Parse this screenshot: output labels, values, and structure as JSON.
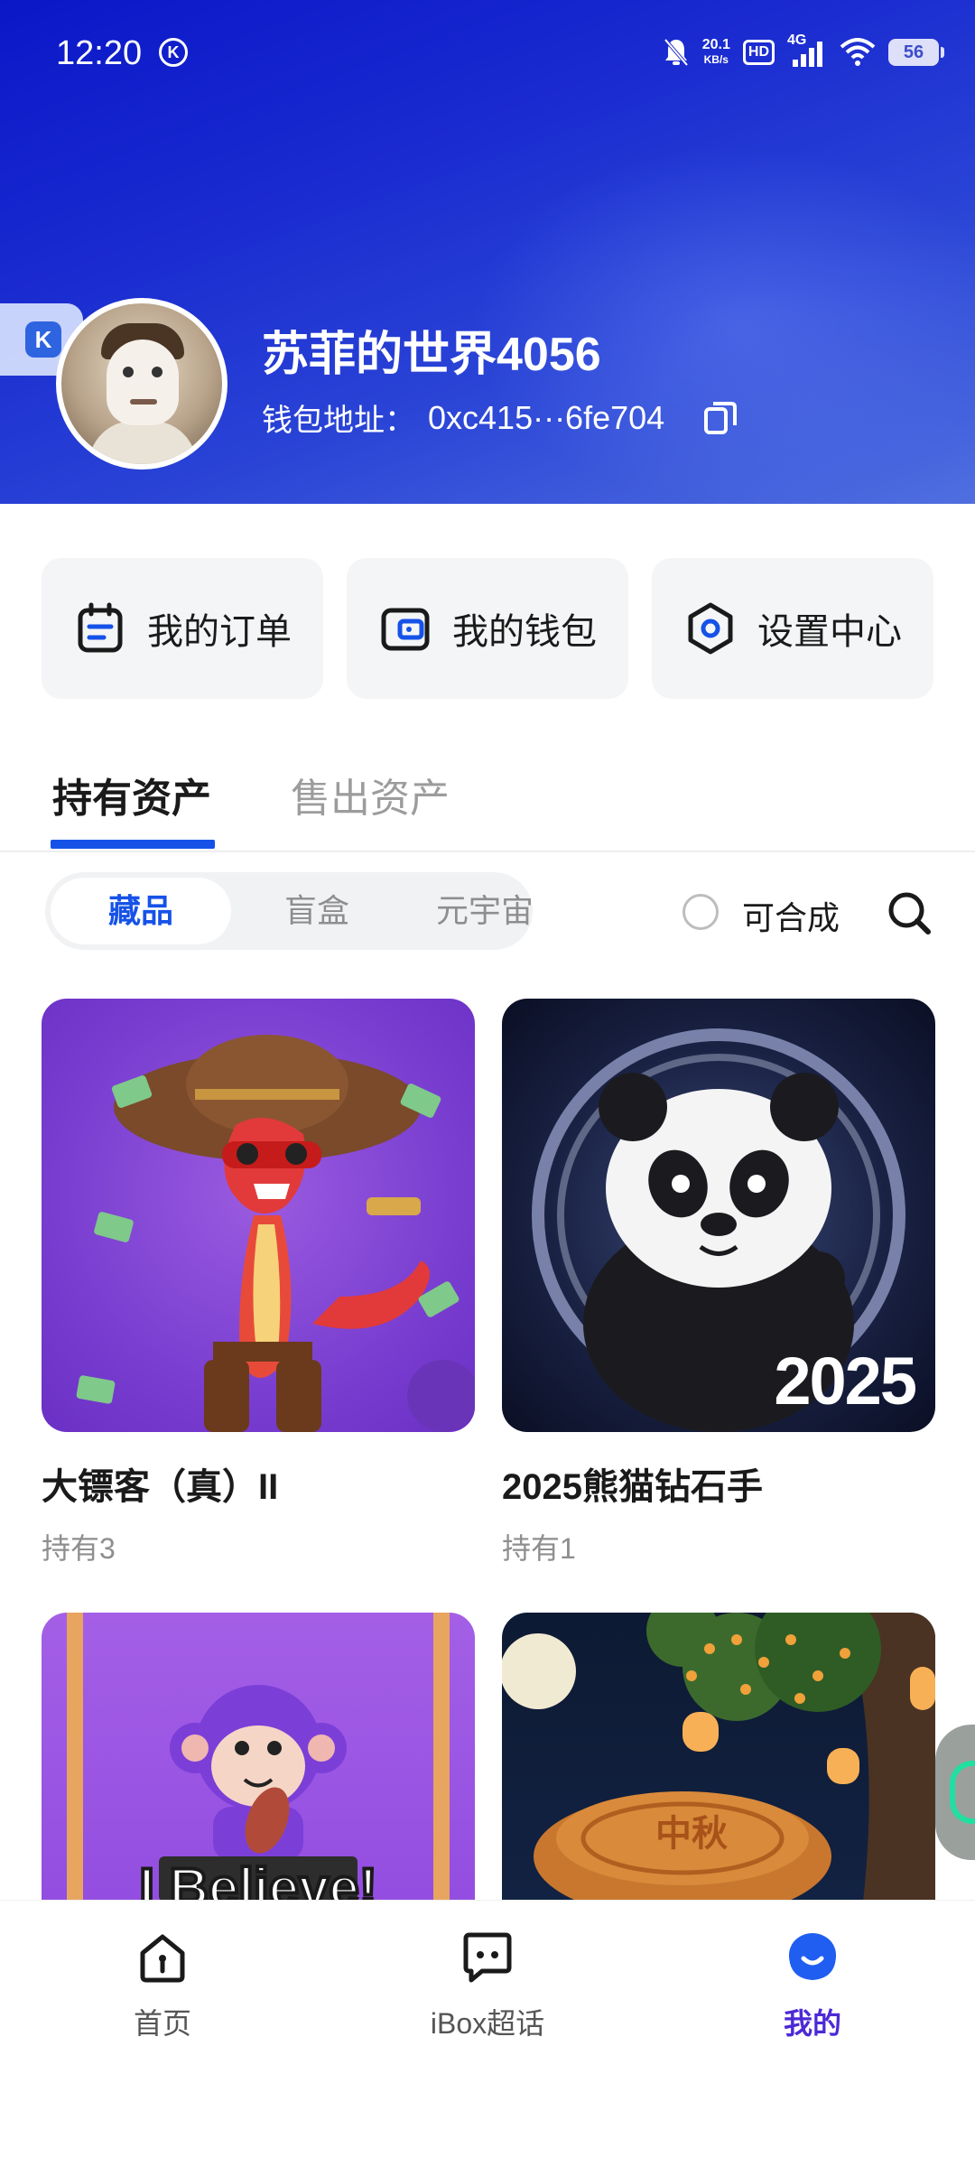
{
  "status_bar": {
    "time": "12:20",
    "k_badge": "K",
    "net_speed_value": "20.1",
    "net_speed_unit": "KB/s",
    "hd": "HD",
    "signal": "4G",
    "battery": "56"
  },
  "profile": {
    "floater_label": "K",
    "username": "苏菲的世界4056",
    "wallet_label": "钱包地址：",
    "wallet_address": "0xc415···6fe704"
  },
  "actions": [
    {
      "label": "我的订单",
      "icon": "order-icon"
    },
    {
      "label": "我的钱包",
      "icon": "wallet-icon"
    },
    {
      "label": "设置中心",
      "icon": "settings-icon"
    }
  ],
  "tabs": {
    "held": "持有资产",
    "sold": "售出资产"
  },
  "filter": {
    "segments": [
      "藏品",
      "盲盒",
      "元宇宙"
    ],
    "selected": "藏品",
    "synth_label": "可合成"
  },
  "collections": [
    {
      "title": "大镖客（真）II",
      "holding": "持有3",
      "image": "snake-cowboy"
    },
    {
      "title": "2025熊猫钻石手",
      "holding": "持有1",
      "image": "panda",
      "overlay_text": "2025"
    },
    {
      "title": "",
      "holding": "",
      "image": "purple-monkey",
      "overlay_text": "I Believe!"
    },
    {
      "title": "",
      "holding": "",
      "image": "mooncake",
      "overlay_text": "中秋"
    }
  ],
  "bottom_nav": [
    {
      "label": "首页",
      "icon": "home-icon"
    },
    {
      "label": "iBox超话",
      "icon": "chat-icon"
    },
    {
      "label": "我的",
      "icon": "profile-icon",
      "active": true
    }
  ],
  "colors": {
    "accent": "#1652e8",
    "nav_active": "#4b2ad6",
    "header_start": "#0a17c8",
    "header_end": "#4f6fe0"
  }
}
